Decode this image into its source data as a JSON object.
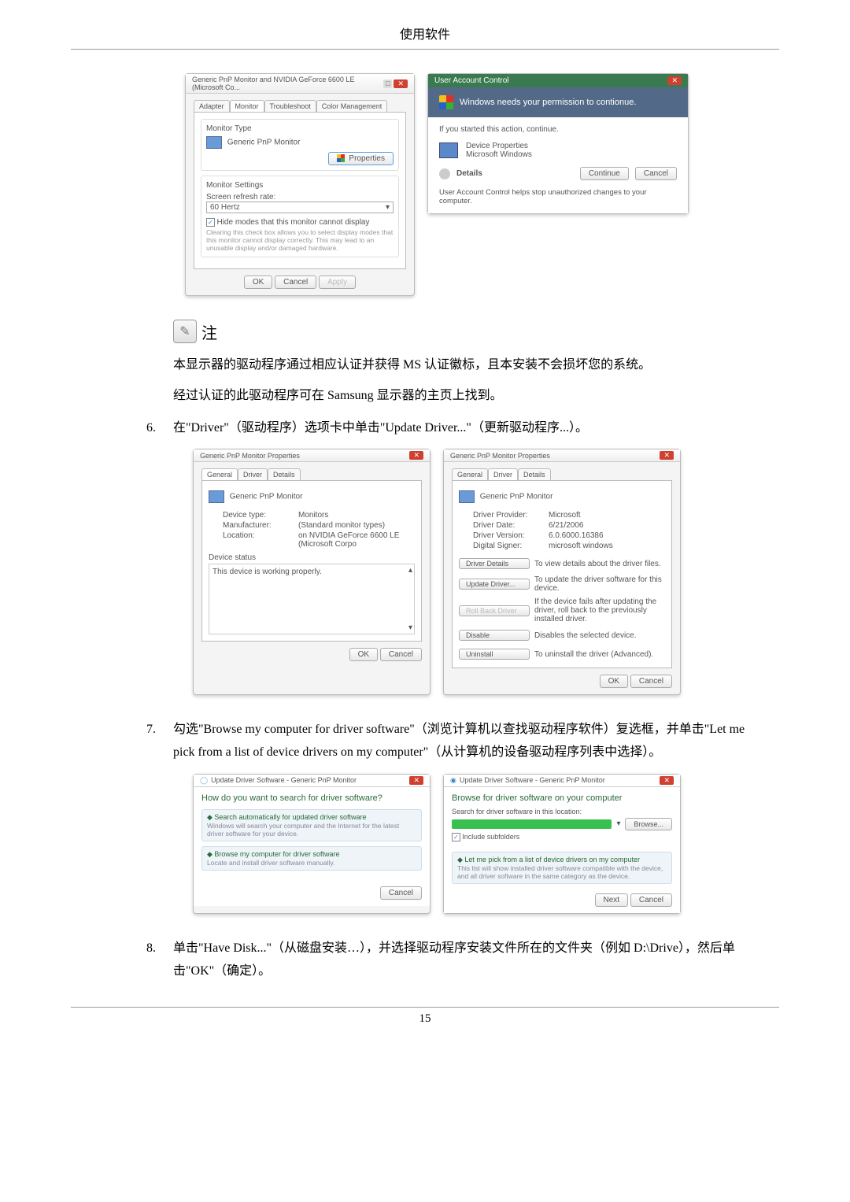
{
  "header": {
    "title": "使用软件"
  },
  "footer": {
    "page_number": "15"
  },
  "dialog1": {
    "title": "Generic PnP Monitor and NVIDIA GeForce 6600 LE (Microsoft Co...",
    "tabs": [
      "Adapter",
      "Monitor",
      "Troubleshoot",
      "Color Management"
    ],
    "monitor_type_label": "Monitor Type",
    "monitor_name": "Generic PnP Monitor",
    "properties_btn": "Properties",
    "settings_label": "Monitor Settings",
    "refresh_label": "Screen refresh rate:",
    "refresh_value": "60 Hertz",
    "hide_modes": "Hide modes that this monitor cannot display",
    "hide_desc": "Clearing this check box allows you to select display modes that this monitor cannot display correctly. This may lead to an unusable display and/or damaged hardware.",
    "ok": "OK",
    "cancel": "Cancel",
    "apply": "Apply"
  },
  "uac": {
    "title": "User Account Control",
    "message": "Windows needs your permission to contionue.",
    "continue_if": "If you started this action, continue.",
    "device_prop": "Device Properties",
    "ms_windows": "Microsoft Windows",
    "details": "Details",
    "continue": "Continue",
    "cancel": "Cancel",
    "footer": "User Account Control helps stop unauthorized changes to your computer."
  },
  "note": {
    "label": "注"
  },
  "paragraph1": "本显示器的驱动程序通过相应认证并获得 MS 认证徽标，且本安装不会损坏您的系统。",
  "paragraph2": "经过认证的此驱动程序可在 Samsung 显示器的主页上找到。",
  "step6": {
    "num": "6.",
    "text": "在\"Driver\"（驱动程序）选项卡中单击\"Update Driver...\"（更新驱动程序...）。"
  },
  "props1": {
    "title": "Generic PnP Monitor Properties",
    "tabs": [
      "General",
      "Driver",
      "Details"
    ],
    "monitor_name": "Generic PnP Monitor",
    "device_type_l": "Device type:",
    "device_type_v": "Monitors",
    "manufacturer_l": "Manufacturer:",
    "manufacturer_v": "(Standard monitor types)",
    "location_l": "Location:",
    "location_v": "on NVIDIA GeForce 6600 LE (Microsoft Corpo",
    "status_label": "Device status",
    "status_text": "This device is working properly.",
    "ok": "OK",
    "cancel": "Cancel"
  },
  "props2": {
    "title": "Generic PnP Monitor Properties",
    "tabs": [
      "General",
      "Driver",
      "Details"
    ],
    "monitor_name": "Generic PnP Monitor",
    "provider_l": "Driver Provider:",
    "provider_v": "Microsoft",
    "date_l": "Driver Date:",
    "date_v": "6/21/2006",
    "version_l": "Driver Version:",
    "version_v": "6.0.6000.16386",
    "signer_l": "Digital Signer:",
    "signer_v": "microsoft windows",
    "btn_details": "Driver Details",
    "btn_details_desc": "To view details about the driver files.",
    "btn_update": "Update Driver...",
    "btn_update_desc": "To update the driver software for this device.",
    "btn_rollback": "Roll Back Driver",
    "btn_rollback_desc": "If the device fails after updating the driver, roll back to the previously installed driver.",
    "btn_disable": "Disable",
    "btn_disable_desc": "Disables the selected device.",
    "btn_uninstall": "Uninstall",
    "btn_uninstall_desc": "To uninstall the driver (Advanced).",
    "ok": "OK",
    "cancel": "Cancel"
  },
  "step7": {
    "num": "7.",
    "text": "勾选\"Browse my computer for driver software\"（浏览计算机以查找驱动程序软件）复选框，并单击\"Let me pick from a list of device drivers on my computer\"（从计算机的设备驱动程序列表中选择）。"
  },
  "wizard1": {
    "title": "Update Driver Software - Generic PnP Monitor",
    "heading": "How do you want to search for driver software?",
    "opt1": "Search automatically for updated driver software",
    "opt1_desc": "Windows will search your computer and the Internet for the latest driver software for your device.",
    "opt2": "Browse my computer for driver software",
    "opt2_desc": "Locate and install driver software manually.",
    "cancel": "Cancel"
  },
  "wizard2": {
    "title": "Update Driver Software - Generic PnP Monitor",
    "heading": "Browse for driver software on your computer",
    "search_label": "Search for driver software in this location:",
    "browse": "Browse...",
    "include": "Include subfolders",
    "opt": "Let me pick from a list of device drivers on my computer",
    "opt_desc": "This list will show installed driver software compatible with the device, and all driver software in the same category as the device.",
    "next": "Next",
    "cancel": "Cancel"
  },
  "step8": {
    "num": "8.",
    "text": "单击\"Have Disk...\"（从磁盘安装…），并选择驱动程序安装文件所在的文件夹（例如 D:\\Drive），然后单击\"OK\"（确定）。"
  }
}
